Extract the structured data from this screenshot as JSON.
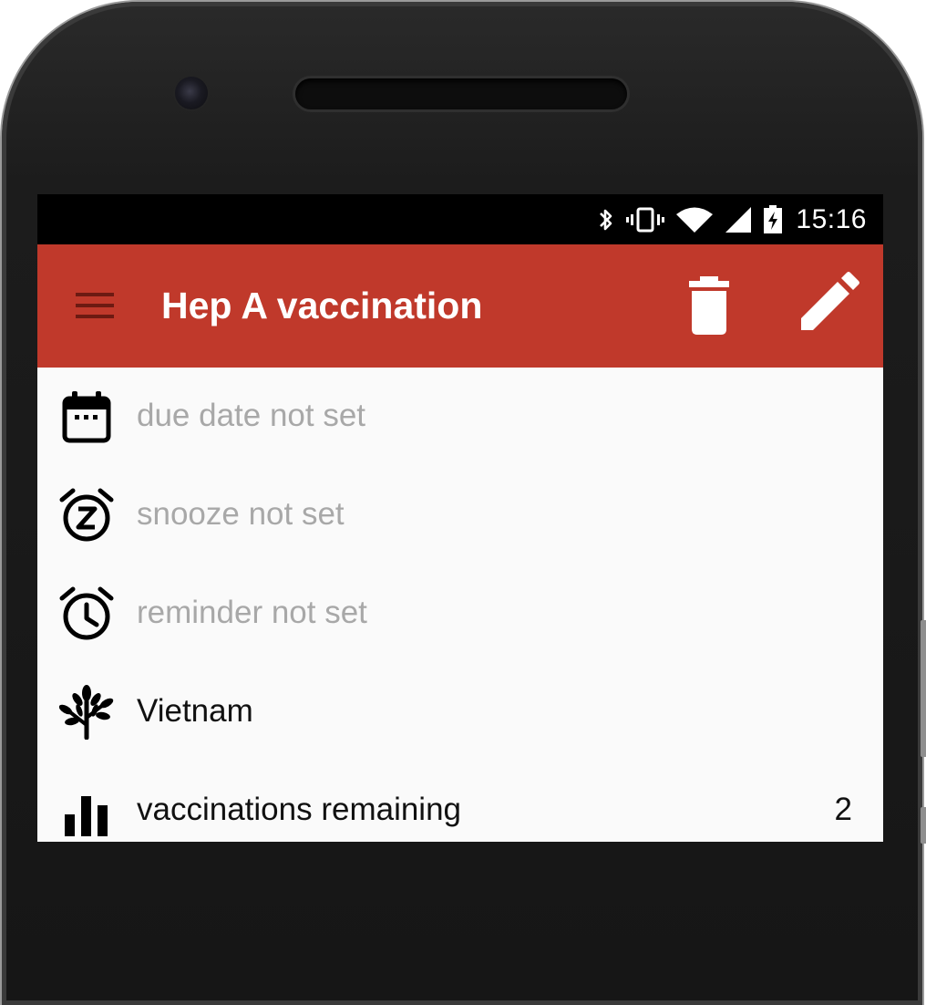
{
  "status_bar": {
    "time": "15:16",
    "icons": [
      "bluetooth-icon",
      "vibrate-icon",
      "wifi-icon",
      "cell-signal-icon",
      "battery-charging-icon"
    ]
  },
  "app_bar": {
    "title": "Hep A vaccination",
    "background": "#c0392b",
    "actions": [
      "menu-icon",
      "trash-icon",
      "edit-pencil-icon"
    ]
  },
  "items": [
    {
      "icon": "calendar-icon",
      "label": "due date not set",
      "muted": true
    },
    {
      "icon": "snooze-alarm-icon",
      "label": "snooze not set",
      "muted": true
    },
    {
      "icon": "alarm-clock-icon",
      "label": "reminder not set",
      "muted": true
    },
    {
      "icon": "tree-icon",
      "label": "Vietnam",
      "muted": false
    },
    {
      "icon": "bar-chart-icon",
      "label": "vaccinations remaining",
      "value": "2",
      "muted": false
    }
  ],
  "colors": {
    "accent": "#c0392b",
    "muted_text": "#a8a8a8",
    "body_text": "#111111"
  }
}
